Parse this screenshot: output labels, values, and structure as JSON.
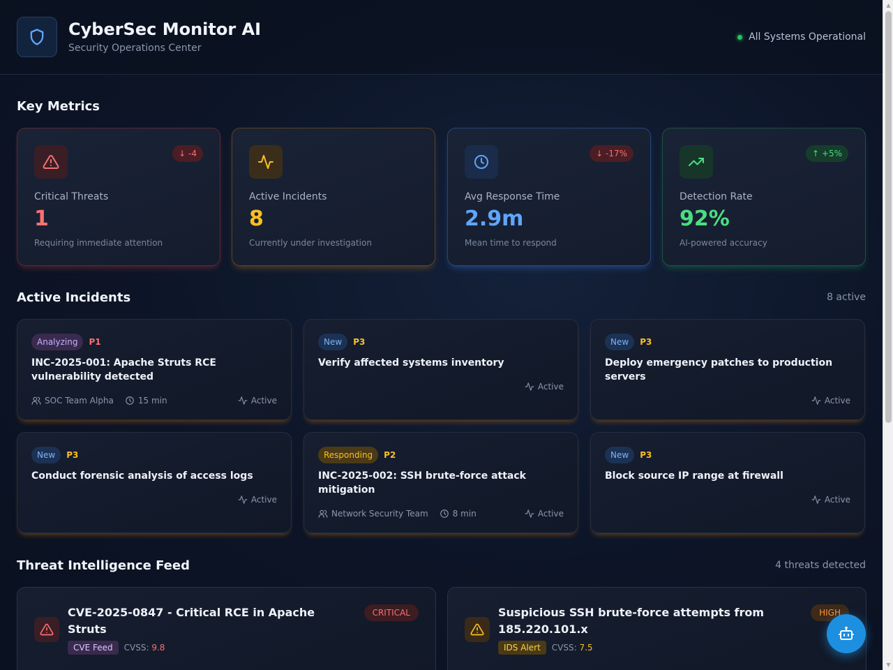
{
  "header": {
    "title": "CyberSec Monitor AI",
    "subtitle": "Security Operations Center",
    "status": "All Systems Operational",
    "logo_icon": "shield-icon"
  },
  "metrics_section": {
    "title": "Key Metrics"
  },
  "metrics": [
    {
      "label": "Critical Threats",
      "value": "1",
      "desc": "Requiring immediate attention",
      "delta": "↓ -4",
      "trend": "down",
      "icon": "alert-triangle-icon",
      "color": "#f87171"
    },
    {
      "label": "Active Incidents",
      "value": "8",
      "desc": "Currently under investigation",
      "delta": "",
      "trend": "",
      "icon": "activity-icon",
      "color": "#fbbf24"
    },
    {
      "label": "Avg Response Time",
      "value": "2.9m",
      "desc": "Mean time to respond",
      "delta": "↓ -17%",
      "trend": "down",
      "icon": "clock-icon",
      "color": "#60a5fa"
    },
    {
      "label": "Detection Rate",
      "value": "92%",
      "desc": "AI-powered accuracy",
      "delta": "↑ +5%",
      "trend": "up",
      "icon": "trending-up-icon",
      "color": "#4ade80"
    }
  ],
  "incidents_section": {
    "title": "Active Incidents",
    "count": "8 active"
  },
  "incidents": [
    {
      "status": "Analyzing",
      "priority": "P1",
      "title": "INC-2025-001: Apache Struts RCE vulnerability detected",
      "team": "SOC Team Alpha",
      "time": "15 min",
      "state": "Active"
    },
    {
      "status": "New",
      "priority": "P3",
      "title": "Verify affected systems inventory",
      "team": "",
      "time": "",
      "state": "Active"
    },
    {
      "status": "New",
      "priority": "P3",
      "title": "Deploy emergency patches to production servers",
      "team": "",
      "time": "",
      "state": "Active"
    },
    {
      "status": "New",
      "priority": "P3",
      "title": "Conduct forensic analysis of access logs",
      "team": "",
      "time": "",
      "state": "Active"
    },
    {
      "status": "Responding",
      "priority": "P2",
      "title": "INC-2025-002: SSH brute-force attack mitigation",
      "team": "Network Security Team",
      "time": "8 min",
      "state": "Active"
    },
    {
      "status": "New",
      "priority": "P3",
      "title": "Block source IP range at firewall",
      "team": "",
      "time": "",
      "state": "Active"
    }
  ],
  "threats_section": {
    "title": "Threat Intelligence Feed",
    "count": "4 threats detected"
  },
  "threats": [
    {
      "title": "CVE-2025-0847 - Critical RCE in Apache Struts",
      "severity": "CRITICAL",
      "source": "CVE Feed",
      "cvss_label": "CVSS:",
      "cvss": "9.8"
    },
    {
      "title": "Suspicious SSH brute-force attempts from 185.220.101.x",
      "severity": "HIGH",
      "source": "IDS Alert",
      "cvss_label": "CVSS:",
      "cvss": "7.5"
    }
  ],
  "fab": {
    "icon": "bot-icon"
  }
}
